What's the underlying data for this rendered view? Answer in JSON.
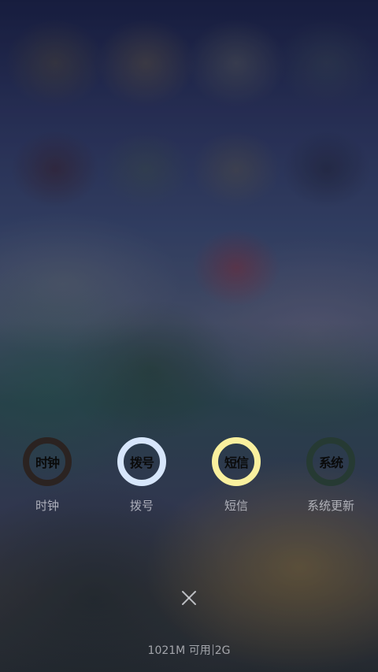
{
  "recent_apps": [
    {
      "id": "clock",
      "icon_text": "时钟",
      "label": "时钟",
      "ring_color": "#2b2321"
    },
    {
      "id": "dialer",
      "icon_text": "拨号",
      "label": "拨号",
      "ring_color": "#d7e6fb"
    },
    {
      "id": "messages",
      "icon_text": "短信",
      "label": "短信",
      "ring_color": "#f9f09e"
    },
    {
      "id": "system-update",
      "icon_text": "系统",
      "label": "系统更新",
      "ring_color": "#263a33"
    }
  ],
  "close_icon": "close-icon",
  "memory": {
    "available": "1021M 可用",
    "total": "2G"
  }
}
